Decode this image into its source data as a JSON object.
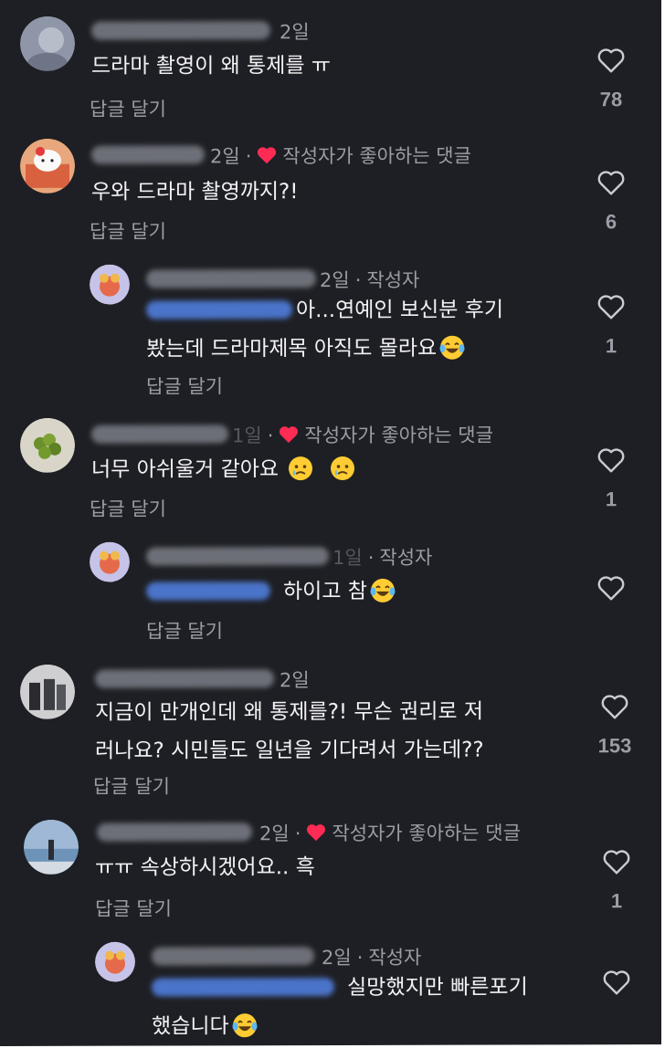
{
  "comments": [
    {
      "time": "2일",
      "author_liked": false,
      "text_lines": [
        "드라마 촬영이 왜 통제를 ㅠ"
      ],
      "reply_label": "답글 달기",
      "likes": "78"
    },
    {
      "time": "2일",
      "author_liked": true,
      "author_liked_label": "작성자가 좋아하는 댓글",
      "text_lines": [
        "우와 드라마 촬영까지?!"
      ],
      "reply_label": "답글 달기",
      "likes": "6",
      "replies": [
        {
          "time": "2일",
          "author_badge": "작성자",
          "text_lines": [
            "아...연예인 보신분 후기",
            "봤는데 드라마제목 아직도 몰라요"
          ],
          "reply_label": "답글 달기",
          "likes": "1",
          "emoji": "laughing-tears"
        }
      ]
    },
    {
      "time": "1일",
      "author_liked": true,
      "author_liked_label": "작성자가 좋아하는 댓글",
      "text_lines": [
        "너무 아쉬울거 같아요"
      ],
      "reply_label": "답글 달기",
      "likes": "1",
      "emoji": "crying-face",
      "replies": [
        {
          "time": "1일",
          "author_badge": "작성자",
          "text_lines": [
            "하이고 참"
          ],
          "reply_label": "답글 달기",
          "emoji": "laughing-tears"
        }
      ]
    },
    {
      "time": "2일",
      "author_liked": false,
      "text_lines": [
        "지금이 만개인데 왜 통제를?! 무슨 권리로 저",
        "러나요? 시민들도 일년을 기다려서 가는데??"
      ],
      "reply_label": "답글 달기",
      "likes": "153"
    },
    {
      "time": "2일",
      "author_liked": true,
      "author_liked_label": "작성자가 좋아하는 댓글",
      "text_lines": [
        "ㅠㅠ 속상하시겠어요.. 흑"
      ],
      "reply_label": "답글 달기",
      "likes": "1",
      "replies": [
        {
          "time": "2일",
          "author_badge": "작성자",
          "text_lines": [
            "실망했지만 빠른포기",
            "했습니다"
          ],
          "emoji": "laughing-tears"
        }
      ]
    }
  ],
  "colors": {
    "background": "#1e1f24",
    "text": "#f2f2f4",
    "muted": "#9a9da6",
    "heart_red": "#fe2c55",
    "mention_blue": "#4a74c9"
  },
  "icons": {
    "like": "heart-outline-icon",
    "author_liked": "red-heart-icon"
  }
}
